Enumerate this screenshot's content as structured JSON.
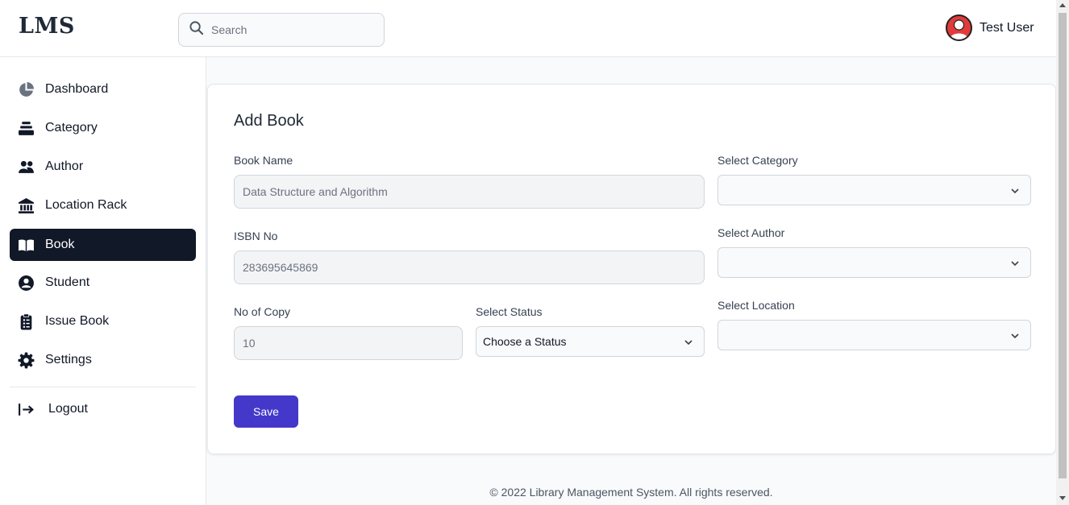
{
  "header": {
    "logo": "LMS",
    "search_placeholder": "Search",
    "user_name": "Test User"
  },
  "sidebar": {
    "items": [
      {
        "label": "Dashboard",
        "icon": "pie-chart-icon"
      },
      {
        "label": "Category",
        "icon": "layers-icon"
      },
      {
        "label": "Author",
        "icon": "users-icon"
      },
      {
        "label": "Location Rack",
        "icon": "building-icon"
      },
      {
        "label": "Book",
        "icon": "book-open-icon",
        "active": true
      },
      {
        "label": "Student",
        "icon": "user-circle-icon"
      },
      {
        "label": "Issue Book",
        "icon": "clipboard-icon"
      },
      {
        "label": "Settings",
        "icon": "gear-icon"
      }
    ],
    "logout_label": "Logout"
  },
  "form": {
    "title": "Add Book",
    "book_name_label": "Book Name",
    "book_name_value": "Data Structure and Algorithm",
    "isbn_label": "ISBN No",
    "isbn_value": "283695645869",
    "copies_label": "No of Copy",
    "copies_value": "10",
    "status_label": "Select Status",
    "status_value": "Choose a Status",
    "category_label": "Select Category",
    "category_value": "",
    "author_label": "Select Author",
    "author_value": "",
    "location_label": "Select Location",
    "location_value": "",
    "save_label": "Save"
  },
  "footer": {
    "text": "© 2022 Library Management System. All rights reserved."
  },
  "colors": {
    "primary_button": "#4338ca",
    "active_nav": "#111827",
    "avatar": "#e23b3b"
  }
}
